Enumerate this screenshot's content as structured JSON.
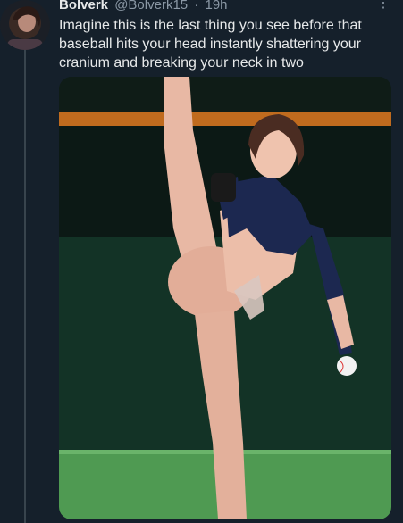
{
  "tweet": {
    "display_name": "Bolverk",
    "handle": "@Bolverk15",
    "separator": "·",
    "time": "19h",
    "text": "Imagine this is the last thing you see before that baseball hits your head instantly shattering your cranium and breaking your neck in two",
    "more_icon": "more-vertical-icon"
  },
  "media": {
    "icon": "photo-image",
    "colors": {
      "stands": "#0f1c17",
      "orange_stripe": "#d4741f",
      "outfield_wall": "#133326",
      "grass": "#4f9a52",
      "skin": "#e8b8a4",
      "top": "#1c2850"
    }
  }
}
